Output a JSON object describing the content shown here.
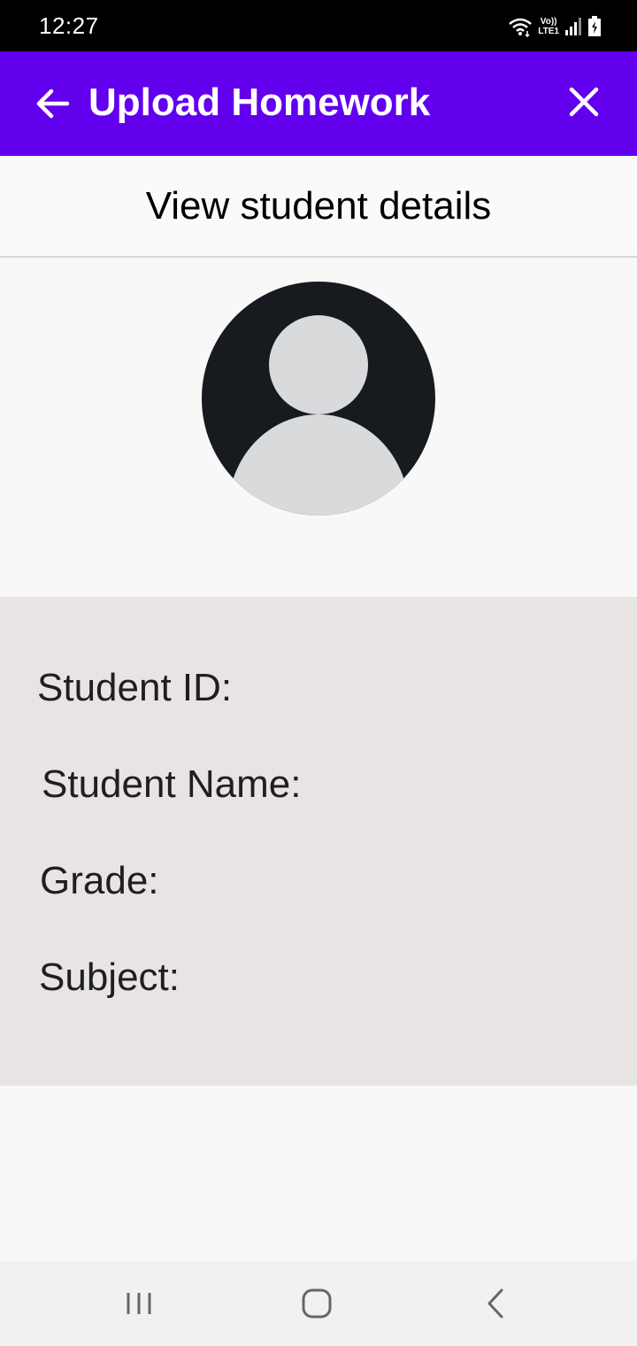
{
  "status_bar": {
    "time": "12:27",
    "icons": [
      "wifi-icon",
      "volte-lte-icon",
      "signal-icon",
      "battery-icon"
    ],
    "lte_top": "Vo))",
    "lte_bottom": "LTE1"
  },
  "app_bar": {
    "title": "Upload Homework",
    "background_color": "#6200ee",
    "back_icon": "arrow-left-icon",
    "close_icon": "close-icon"
  },
  "subheader": {
    "title": "View student details"
  },
  "avatar": {
    "icon": "default-user-avatar"
  },
  "details": {
    "student_id_label": "Student ID:",
    "student_name_label": "Student Name:",
    "grade_label": "Grade:",
    "subject_label": "Subject:"
  },
  "nav_bar": {
    "buttons": [
      "recent-apps-icon",
      "home-icon",
      "back-icon"
    ]
  }
}
